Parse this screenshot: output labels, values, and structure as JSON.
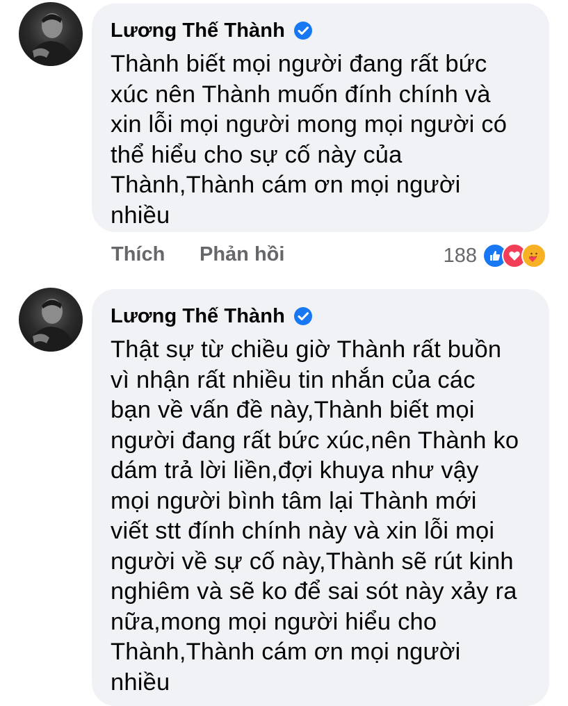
{
  "comments": [
    {
      "author": "Lương Thế Thành",
      "verified": true,
      "text": "Thành biết mọi người đang rất bức\nxúc nên Thành muốn đính chính và\nxin lỗi mọi người mong mọi người có\nthể hiểu cho sự cố này của\nThành,Thành cám ơn mọi người\nnhiều",
      "like_label": "Thích",
      "reply_label": "Phản hồi",
      "reaction_count": "188",
      "reactions": [
        "like-icon",
        "love-icon",
        "care-icon"
      ]
    },
    {
      "author": "Lương Thế Thành",
      "verified": true,
      "text": "Thật sự từ chiều giờ Thành rất buồn\nvì nhận rất nhiều tin nhắn của các\nbạn về vấn đề này,Thành biết mọi\nngười đang rất bức xúc,nên Thành ko\ndám trả lời liền,đợi khuya như vậy\nmọi người bình tâm lại Thành mới\nviết stt đính chính này và xin lỗi mọi\nngười về sự cố này,Thành sẽ rút kinh\nnghiêm và sẽ ko để sai sót này xảy ra\nnữa,mong mọi người hiểu cho\nThành,Thành cám ơn mọi người\nnhiều"
    }
  ],
  "colors": {
    "bubble": "#f0f2f5",
    "verified": "#1877f2",
    "like": "#1877f2",
    "love": "#f33e58",
    "care": "#f7b125",
    "muted_text": "#65676b"
  }
}
